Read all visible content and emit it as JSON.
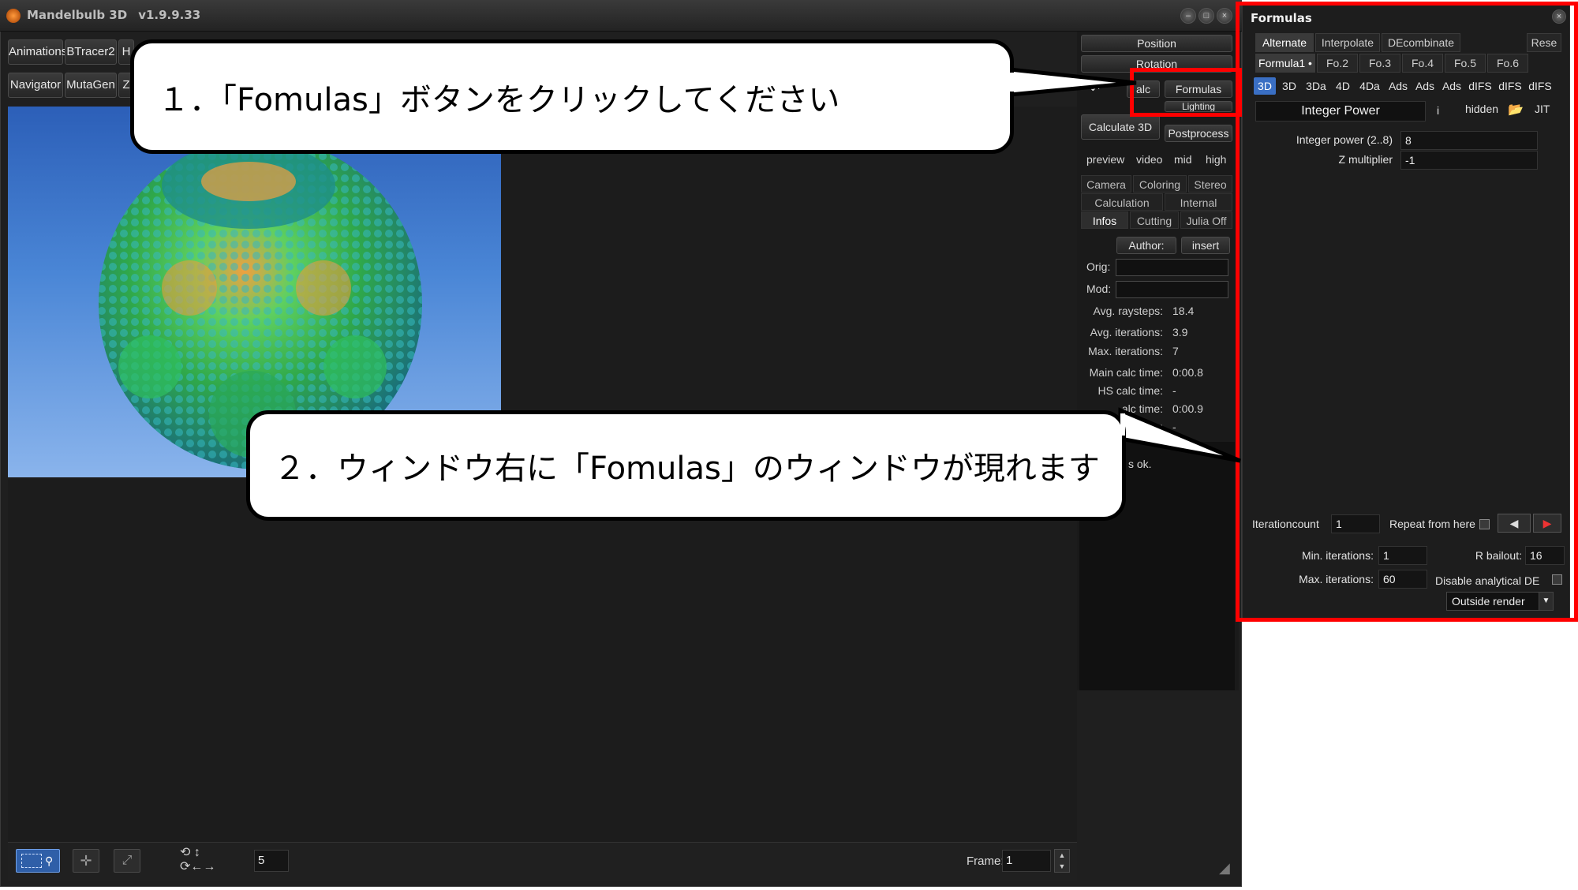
{
  "window": {
    "title": "Mandelbulb 3D",
    "version": "v1.9.9.33",
    "min_glyph": "–",
    "max_glyph": "□",
    "close_glyph": "×"
  },
  "toolbar": {
    "animations": "Animations",
    "btracer2": "BTracer2",
    "h_partial": "H",
    "navigator": "Navigator",
    "mutagen": "MutaGen",
    "z_partial": "Z"
  },
  "right_panel": {
    "position": "Position",
    "rotation": "Rotation",
    "calc_partial": "alc",
    "formulas": "Formulas",
    "lighting_partial": "Lighting",
    "calculate3d": "Calculate 3D",
    "postprocess": "Postprocess",
    "quality": [
      "preview",
      "video",
      "mid",
      "high"
    ],
    "tabs_row1": [
      "Camera",
      "Coloring",
      "Stereo"
    ],
    "tabs_row2": [
      "Calculation",
      "Internal"
    ],
    "tabs_row3": [
      "Infos",
      "Cutting",
      "Julia Off"
    ],
    "author": "Author:",
    "insert": "insert",
    "orig": "Orig:",
    "mod": "Mod:",
    "info": [
      {
        "label": "Avg. raysteps:",
        "value": "18.4"
      },
      {
        "label": "Avg. iterations:",
        "value": "3.9"
      },
      {
        "label": "Max. iterations:",
        "value": "7"
      },
      {
        "label": "Main calc time:",
        "value": "0:00.8"
      },
      {
        "label": "HS calc time:",
        "value": "-"
      },
      {
        "label": "alc time:",
        "value": "0:00.9"
      },
      {
        "label": "time:",
        "value": "-"
      }
    ],
    "status": "s ok."
  },
  "bottom_bar": {
    "steps_value": "5",
    "frame_label": "Frame:",
    "frame_value": "1"
  },
  "formulas": {
    "title": "Formulas",
    "top_tabs": [
      "Alternate",
      "Interpolate",
      "DEcombinate"
    ],
    "reset_partial": "Rese",
    "formula_tabs": [
      "Formula1 •",
      "Fo.2",
      "Fo.3",
      "Fo.4",
      "Fo.5",
      "Fo.6"
    ],
    "types": [
      "3D",
      "3D",
      "3Da",
      "4D",
      "4Da",
      "Ads",
      "Ads",
      "Ads",
      "dIFS",
      "dIFS",
      "dIFS"
    ],
    "formula_name": "Integer Power",
    "info_glyph": "i",
    "hidden": "hidden",
    "jit": "JIT",
    "params": [
      {
        "label": "Integer power (2..8)",
        "value": "8"
      },
      {
        "label": "Z multiplier",
        "value": "-1"
      }
    ],
    "iterationcount_label": "Iterationcount",
    "iterationcount_value": "1",
    "repeat_label": "Repeat from here",
    "min_iter_label": "Min. iterations:",
    "min_iter_value": "1",
    "max_iter_label": "Max. iterations:",
    "max_iter_value": "60",
    "rbailout_label": "R bailout:",
    "rbailout_value": "16",
    "disable_de_label": "Disable analytical DE",
    "outside_render": "Outside render"
  },
  "callouts": {
    "step1": "１．「Fomulas」ボタンをクリックしてください",
    "step2": "２．ウィンドウ右に「Fomulas」のウィンドウが現れます"
  },
  "colors": {
    "highlight": "#ff0000",
    "selected_type": "#3a6fc4",
    "background_sky": "#4a86d6"
  }
}
